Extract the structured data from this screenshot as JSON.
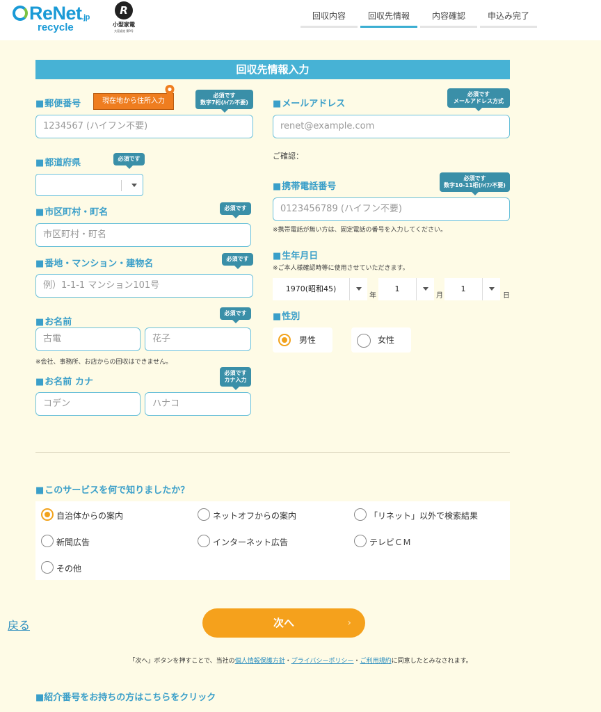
{
  "header": {
    "logo_main": "ReNet",
    "logo_jp": ".jp",
    "logo_sub": "recycle",
    "badge_mark": "R",
    "badge_text": "小型家電",
    "badge_small": "大臣認定 第9号",
    "steps": [
      {
        "label": "回収内容",
        "active": false
      },
      {
        "label": "回収先情報",
        "active": true
      },
      {
        "label": "内容確認",
        "active": false
      },
      {
        "label": "申込み完了",
        "active": false
      }
    ]
  },
  "form": {
    "section_title": "回収先情報入力",
    "postal": {
      "label": "郵便番号",
      "geo_button": "現在地から住所入力",
      "req_line1": "必須です",
      "req_line2": "数字7桁(ﾊｲﾌﾝ不要)",
      "placeholder": "1234567 (ハイフン不要)"
    },
    "prefecture": {
      "label": "都道府県",
      "req": "必須です",
      "value": ""
    },
    "city": {
      "label": "市区町村・町名",
      "req": "必須です",
      "placeholder": "市区町村・町名"
    },
    "address": {
      "label": "番地・マンション・建物名",
      "req": "必須です",
      "placeholder": "例）1-1-1 マンション101号"
    },
    "name": {
      "label": "お名前",
      "req": "必須です",
      "last_placeholder": "古電",
      "first_placeholder": "花子",
      "note": "※会社、事務所、お店からの回収はできません。"
    },
    "kana": {
      "label": "お名前 カナ",
      "req_line1": "必須です",
      "req_line2": "カナ入力",
      "last_placeholder": "コデン",
      "first_placeholder": "ハナコ"
    },
    "email": {
      "label": "メールアドレス",
      "req_line1": "必須です",
      "req_line2": "メールアドレス方式",
      "placeholder": "renet@example.com",
      "confirm_label": "ご確認："
    },
    "phone": {
      "label": "携帯電話番号",
      "req_line1": "必須です",
      "req_line2": "数字10-11桁(ﾊｲﾌﾝ不要)",
      "placeholder": "0123456789 (ハイフン不要)",
      "note": "※携帯電話が無い方は、固定電話の番号を入力してください。"
    },
    "birthdate": {
      "label": "生年月日",
      "note": "※ご本人様確認時等に使用させていただきます。",
      "year": "1970(昭和45)",
      "year_unit": "年",
      "month": "1",
      "month_unit": "月",
      "day": "1",
      "day_unit": "日"
    },
    "gender": {
      "label": "性別",
      "options": [
        {
          "label": "男性",
          "selected": true
        },
        {
          "label": "女性",
          "selected": false
        }
      ]
    }
  },
  "survey": {
    "question": "このサービスを何で知りましたか？",
    "options": [
      {
        "label": "自治体からの案内",
        "selected": true
      },
      {
        "label": "ネットオフからの案内",
        "selected": false
      },
      {
        "label": "「リネット」以外で検索結果",
        "selected": false
      },
      {
        "label": "新聞広告",
        "selected": false
      },
      {
        "label": "インターネット広告",
        "selected": false
      },
      {
        "label": "テレビＣＭ",
        "selected": false
      },
      {
        "label": "その他",
        "selected": false
      }
    ]
  },
  "footer": {
    "back_label": "戻る",
    "next_label": "次へ",
    "next_chevron": "›",
    "consent_pre": "「次へ」ボタンを押すことで、当社の",
    "consent_link1": "個人情報保護方針",
    "consent_sep1": "・",
    "consent_link2": "プライバシーポリシー",
    "consent_sep2": "・",
    "consent_link3": "ご利用規約",
    "consent_post": "に同意したとみなされます。",
    "referral_label": "■紹介番号をお持ちの方はこちらをクリック"
  },
  "colors": {
    "accent": "#47b2d5",
    "label": "#3a9fc9",
    "orange": "#f5a11c",
    "background": "#fefbe6"
  }
}
